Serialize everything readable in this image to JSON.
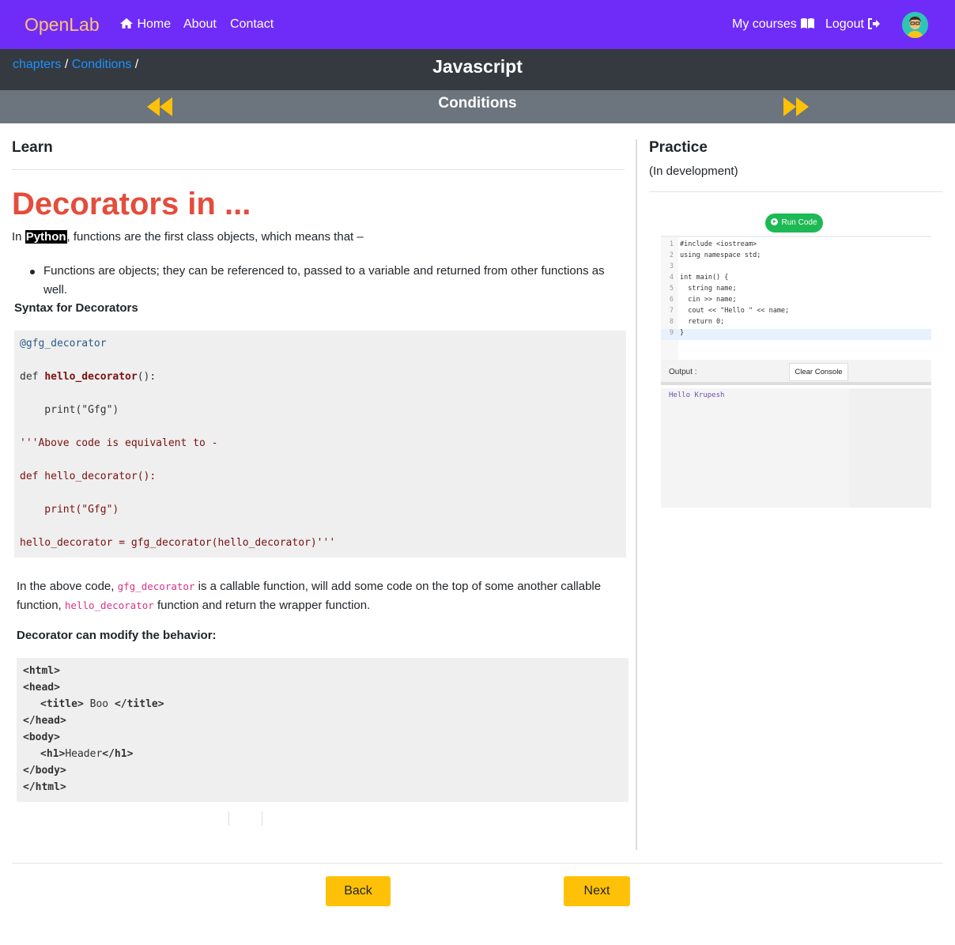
{
  "navbar": {
    "brand": "OpenLab",
    "home": "Home",
    "about": "About",
    "contact": "Contact",
    "my_courses": "My courses",
    "logout": "Logout"
  },
  "course": {
    "breadcrumb": [
      "chapters",
      "Conditions"
    ],
    "separator": "/",
    "title": "Javascript"
  },
  "chapter": {
    "title": "Conditions"
  },
  "learn": {
    "heading": "Learn",
    "title": "Decorators in ...",
    "intro_prefix": "In",
    "intro_highlight": "Python",
    "intro_suffix": ", functions are the first class objects, which means that –",
    "bullet": "Functions are objects; they can be referenced to, passed to a variable and returned from other functions as well.",
    "syntax_heading": "Syntax for Decorators",
    "code1": [
      "@gfg_decorator",
      "def",
      "hello_decorator",
      "():",
      "    print(\"Gfg\")",
      "'''Above code is equivalent to -",
      "def hello_decorator():",
      "    print(\"Gfg\")",
      "hello_decorator = gfg_decorator(hello_decorator)'''"
    ],
    "para_1": "In the above code,",
    "para_code1": "gfg_decorator",
    "para_2": "is a callable function, will add some code on the top of some another callable function,",
    "para_code2": "hello_decorator",
    "para_3": "function and return the wrapper function.",
    "modify_heading": "Decorator can modify the behavior:",
    "code2": {
      "l1": "<html>",
      "l2": "<head>",
      "l3a": "<title>",
      "l3b": " Boo ",
      "l3c": "</title>",
      "l4": "</head>",
      "l5": "<body>",
      "l6a": "<h1>",
      "l6b": "Header",
      "l6c": "</h1>",
      "l7": "</body>",
      "l8": "</html>"
    }
  },
  "practice": {
    "heading": "Practice",
    "status": "(In development)",
    "run_code": "Run Code",
    "editor_lines": [
      "#include <iostream>",
      "using namespace std;",
      "",
      "int main() {",
      "  string name;",
      "  cin >> name;",
      "  cout << \"Hello \" << name;",
      "  return 0;",
      "}"
    ],
    "line_numbers": [
      "1",
      "2",
      "3",
      "4",
      "5",
      "6",
      "7",
      "8",
      "9"
    ],
    "output_label": "Output :",
    "clear_console": "Clear Console",
    "console_output": "Hello Krupesh"
  },
  "footer": {
    "back": "Back",
    "next": "Next"
  },
  "colors": {
    "navbar": "#6f2cf8",
    "brand": "#ffc46b",
    "course_bar": "#343a40",
    "chapter_bar": "#6c757d",
    "arrow": "#ffc107",
    "title_red": "#e44c3c",
    "button_yellow": "#ffc107",
    "run_green": "#1db954"
  },
  "icons": [
    "home-icon",
    "book-icon",
    "logout-icon",
    "avatar",
    "rewind-icon",
    "fast-forward-icon",
    "play-icon"
  ]
}
